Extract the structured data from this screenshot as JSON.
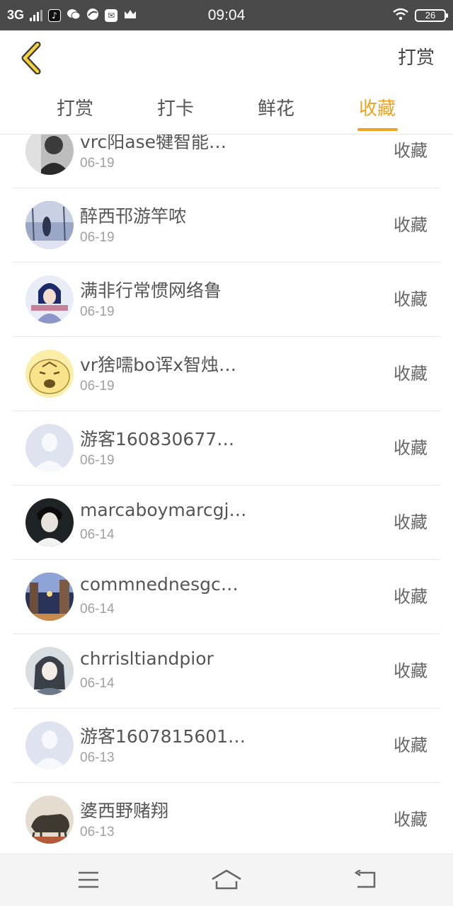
{
  "status_bar": {
    "network": "3G",
    "time": "09:04",
    "battery": "26",
    "app_icons": [
      "tiktok-icon",
      "wechat-icon",
      "browser-icon",
      "mail-icon",
      "crown-icon"
    ]
  },
  "header": {
    "back_icon": "chevron-left-icon",
    "action_label": "打赏"
  },
  "tabs": [
    {
      "label": "打赏",
      "active": false
    },
    {
      "label": "打卡",
      "active": false
    },
    {
      "label": "鲜花",
      "active": false
    },
    {
      "label": "收藏",
      "active": true
    }
  ],
  "colors": {
    "accent": "#f0a323",
    "status_bar_bg": "#4a4a4a",
    "text": "#555555",
    "subtext": "#a0a0a0"
  },
  "list": {
    "items": [
      {
        "name": "vrc阳ase犍智能…",
        "date": "06-19",
        "action": "收藏"
      },
      {
        "name": "醉西邗游竿哝",
        "date": "06-19",
        "action": "收藏"
      },
      {
        "name": "满非行常惯网络鲁",
        "date": "06-19",
        "action": "收藏"
      },
      {
        "name": "vr猞嚅bo诨x智烛…",
        "date": "06-19",
        "action": "收藏"
      },
      {
        "name": "游客160830677…",
        "date": "06-19",
        "action": "收藏"
      },
      {
        "name": "marcaboymarcgj…",
        "date": "06-14",
        "action": "收藏"
      },
      {
        "name": "commnednesgc…",
        "date": "06-14",
        "action": "收藏"
      },
      {
        "name": "chrrisltiandpior",
        "date": "06-14",
        "action": "收藏"
      },
      {
        "name": "游客1607815601…",
        "date": "06-13",
        "action": "收藏"
      },
      {
        "name": "婆西野赌翔",
        "date": "06-13",
        "action": "收藏"
      }
    ]
  },
  "nav_bar": {
    "icons": [
      "menu-icon",
      "home-icon",
      "back-icon"
    ]
  }
}
